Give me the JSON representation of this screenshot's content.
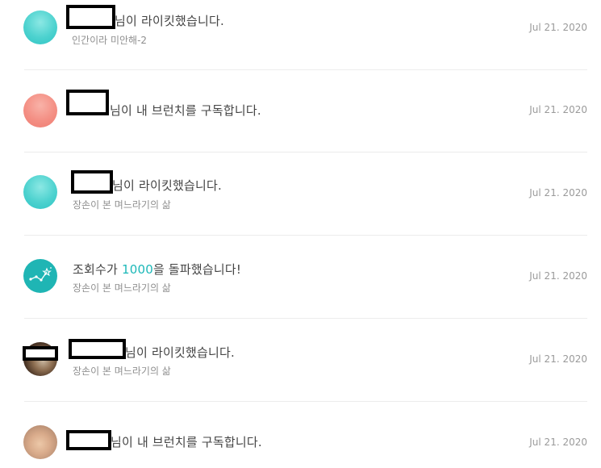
{
  "colors": {
    "accent": "#1cb8b8",
    "divider": "#ececec",
    "date": "#9a9a9a"
  },
  "notifications": [
    {
      "message": "님이 라이킷했습니다.",
      "subtitle": "인간이라 미안해-2",
      "date": "Jul 21. 2020",
      "avatar_icon": "mint-avatar-icon"
    },
    {
      "message": "님이 내 브런치를 구독합니다.",
      "subtitle": "",
      "date": "Jul 21. 2020",
      "avatar_icon": "salmon-avatar-icon"
    },
    {
      "message": "님이 라이킷했습니다.",
      "subtitle": "장손이 본 며느라기의 삶",
      "date": "Jul 21. 2020",
      "avatar_icon": "mint-avatar-icon"
    },
    {
      "message_prefix": "조회수가 ",
      "message_highlight": "1000",
      "message_suffix": "을 돌파했습니다!",
      "subtitle": "장손이 본 며느라기의 삶",
      "date": "Jul 21. 2020",
      "avatar_icon": "milestone-chart-icon"
    },
    {
      "message": "님이 라이킷했습니다.",
      "subtitle": "장손이 본 며느라기의 삶",
      "date": "Jul 21. 2020",
      "avatar_icon": "user-photo-avatar"
    },
    {
      "message": "님이 내 브런치를 구독합니다.",
      "subtitle": "",
      "date": "Jul 21. 2020",
      "avatar_icon": "user-photo-avatar"
    }
  ]
}
